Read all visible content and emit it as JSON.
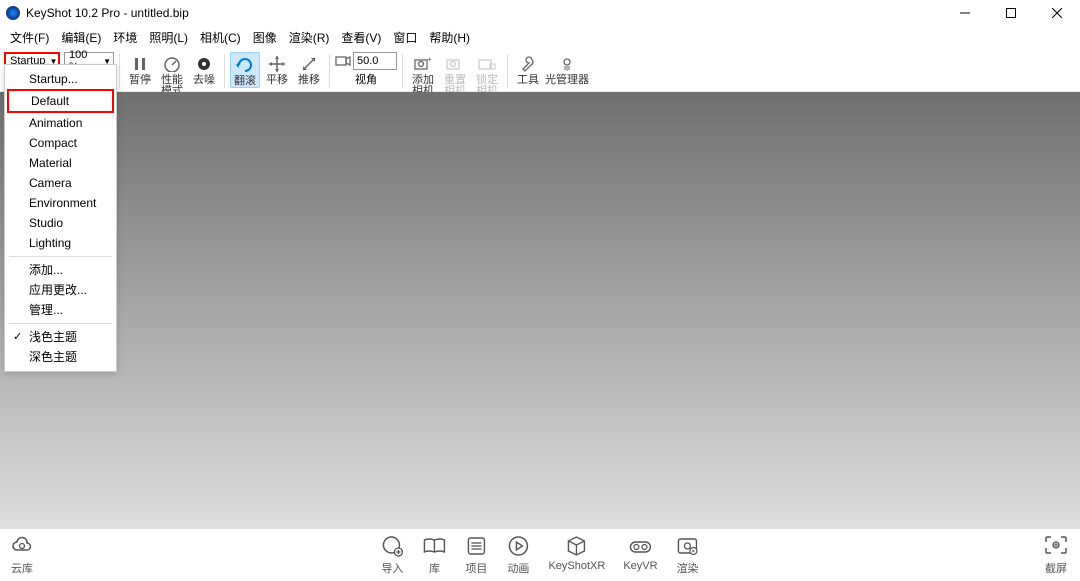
{
  "title": "KeyShot 10.2 Pro  - untitled.bip",
  "menus": [
    "文件(F)",
    "编辑(E)",
    "环境",
    "照明(L)",
    "相机(C)",
    "图像",
    "渲染(R)",
    "查看(V)",
    "窗口",
    "帮助(H)"
  ],
  "workspace_combo": "Startup",
  "zoom_combo": "100 %",
  "toolbar": {
    "pause": "暂停",
    "perf": "性能\n模式",
    "denoise": "去噪",
    "tumble": "翻滚",
    "pan": "平移",
    "dolly": "推移",
    "fov_input": "50.0",
    "fov": "视角",
    "addcam": "添加\n相机",
    "resetcam": "重置\n相机",
    "lockcam": "锁定\n相机",
    "tools": "工具",
    "lightmgr": "光管理器"
  },
  "dropdown": {
    "startup": "Startup...",
    "default": "Default",
    "animation": "Animation",
    "compact": "Compact",
    "material": "Material",
    "camera": "Camera",
    "environment": "Environment",
    "studio": "Studio",
    "lighting": "Lighting",
    "add": "添加...",
    "apply": "应用更改...",
    "manage": "管理...",
    "light_theme": "浅色主题",
    "dark_theme": "深色主题"
  },
  "bottom": {
    "cloud": "云库",
    "import": "导入",
    "library": "库",
    "project": "项目",
    "animation": "动画",
    "keyshotxr": "KeyShotXR",
    "keyvr": "KeyVR",
    "render": "渲染",
    "screenshot": "截屏"
  }
}
